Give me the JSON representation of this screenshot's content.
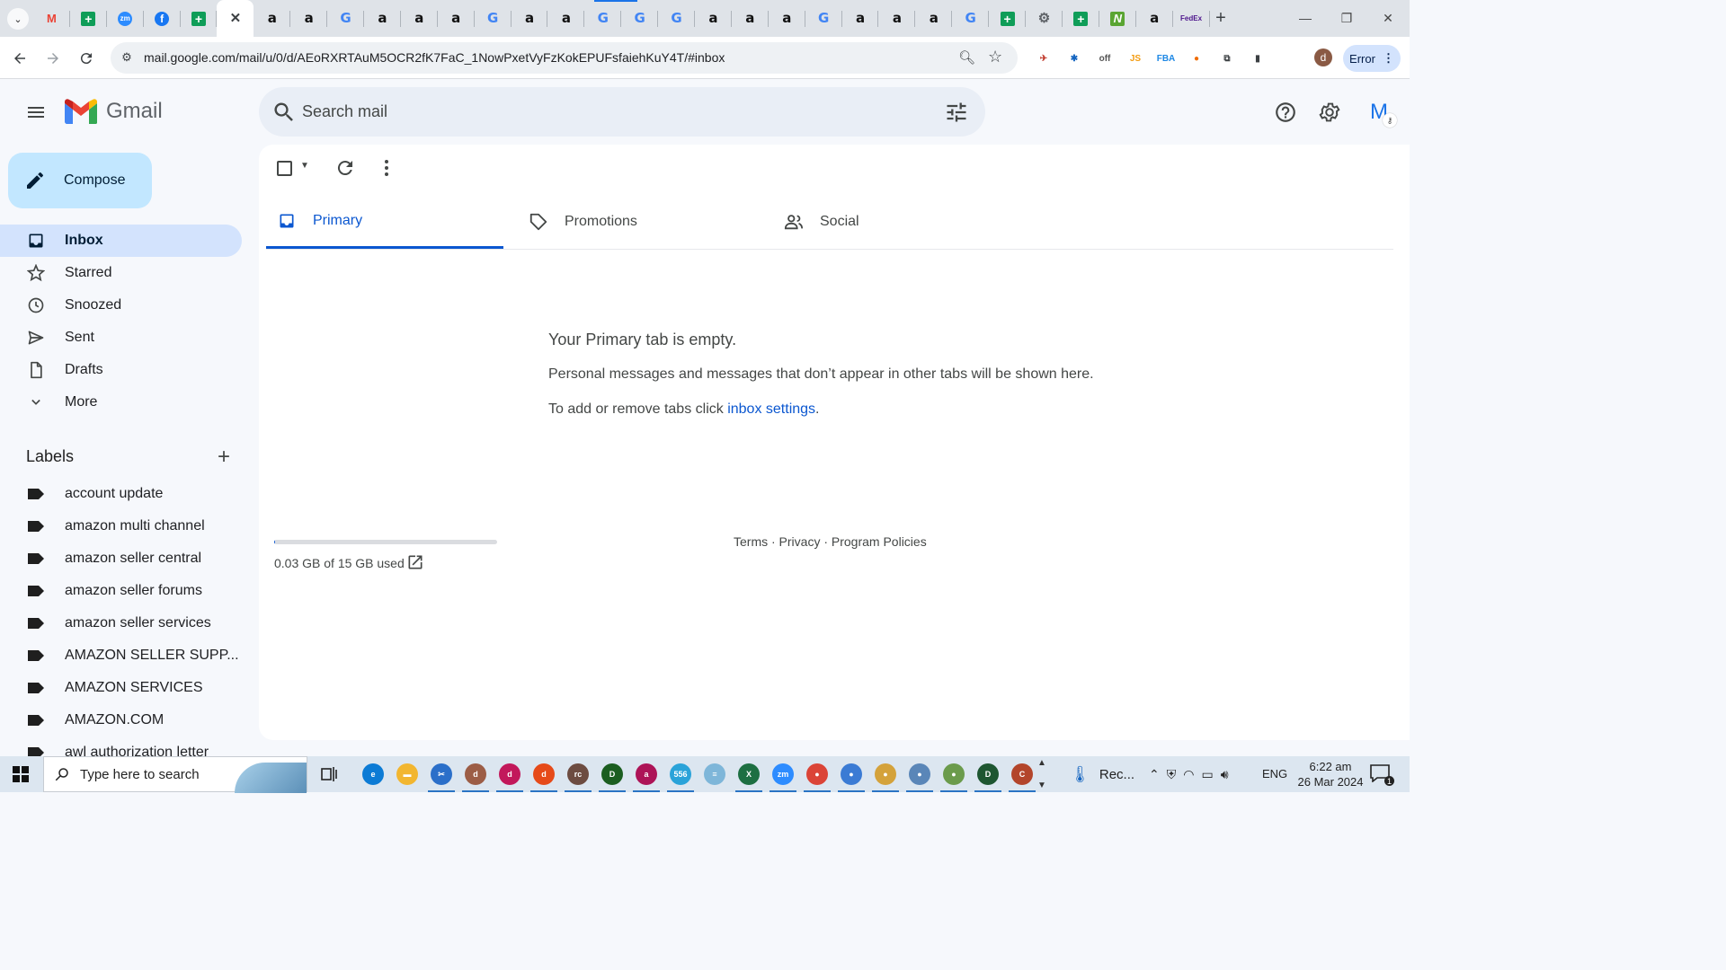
{
  "browser": {
    "tabs": [
      {
        "icon": "gmail-icon",
        "glyph": "M"
      },
      {
        "icon": "sheets-icon",
        "glyph": "+"
      },
      {
        "icon": "zoom-icon",
        "glyph": "zm"
      },
      {
        "icon": "facebook-icon",
        "glyph": "f"
      },
      {
        "icon": "sheets-icon",
        "glyph": "+"
      },
      {
        "icon": "close-icon",
        "glyph": "✕",
        "active": true
      },
      {
        "icon": "amazon-icon",
        "glyph": "a"
      },
      {
        "icon": "amazon-icon",
        "glyph": "a"
      },
      {
        "icon": "google-icon",
        "glyph": "G"
      },
      {
        "icon": "amazon-icon",
        "glyph": "a"
      },
      {
        "icon": "amazon-icon",
        "glyph": "a"
      },
      {
        "icon": "amazon-icon",
        "glyph": "a"
      },
      {
        "icon": "google-icon",
        "glyph": "G"
      },
      {
        "icon": "amazon-icon",
        "glyph": "a"
      },
      {
        "icon": "amazon-icon",
        "glyph": "a"
      },
      {
        "icon": "google-icon",
        "glyph": "G"
      },
      {
        "icon": "google-icon",
        "glyph": "G"
      },
      {
        "icon": "google-icon",
        "glyph": "G"
      },
      {
        "icon": "amazon-icon",
        "glyph": "a"
      },
      {
        "icon": "amazon-icon",
        "glyph": "a"
      },
      {
        "icon": "amazon-icon",
        "glyph": "a"
      },
      {
        "icon": "google-icon",
        "glyph": "G"
      },
      {
        "icon": "amazon-icon",
        "glyph": "a"
      },
      {
        "icon": "amazon-icon",
        "glyph": "a"
      },
      {
        "icon": "amazon-icon",
        "glyph": "a"
      },
      {
        "icon": "google-icon",
        "glyph": "G"
      },
      {
        "icon": "sheets-icon",
        "glyph": "+"
      },
      {
        "icon": "gear-icon",
        "glyph": "⚙"
      },
      {
        "icon": "sheets-icon",
        "glyph": "+"
      },
      {
        "icon": "n-app-icon",
        "glyph": "N"
      },
      {
        "icon": "amazon-icon",
        "glyph": "a"
      },
      {
        "icon": "fedex-icon",
        "glyph": "FedEx"
      }
    ],
    "url": "mail.google.com/mail/u/0/d/AEoRXRTAuM5OCR2fK7FaC_1NowPxetVyFzKokEPUFsfaiehKuY4T/#inbox",
    "profile_initial": "d",
    "error_label": "Error",
    "extensions": [
      {
        "icon": "extension-1-icon",
        "glyph": "✈",
        "color": "#c0392b"
      },
      {
        "icon": "extension-2-icon",
        "glyph": "✱",
        "color": "#1565c0"
      },
      {
        "icon": "extension-off-icon",
        "glyph": "off",
        "color": "#555555"
      },
      {
        "icon": "extension-js-icon",
        "glyph": "JS",
        "color": "#f39c12"
      },
      {
        "icon": "extension-fba-icon",
        "glyph": "FBA",
        "color": "#1e88e5"
      },
      {
        "icon": "extension-circle-icon",
        "glyph": "●",
        "color": "#ef6c00"
      },
      {
        "icon": "puzzle-icon",
        "glyph": "⧉",
        "color": "#3c4043"
      },
      {
        "icon": "side-panel-icon",
        "glyph": "▮",
        "color": "#3c4043"
      }
    ]
  },
  "gmail": {
    "wordmark": "Gmail",
    "search_placeholder": "Search mail",
    "account_initial": "M",
    "compose_label": "Compose",
    "nav": [
      {
        "name": "inbox",
        "label": "Inbox",
        "active": true
      },
      {
        "name": "starred",
        "label": "Starred"
      },
      {
        "name": "snoozed",
        "label": "Snoozed"
      },
      {
        "name": "sent",
        "label": "Sent"
      },
      {
        "name": "drafts",
        "label": "Drafts"
      },
      {
        "name": "more",
        "label": "More"
      }
    ],
    "labels_heading": "Labels",
    "labels": [
      "account update",
      "amazon multi channel",
      "amazon seller central",
      "amazon seller forums",
      "amazon seller services",
      "AMAZON SELLER SUPP...",
      "AMAZON SERVICES",
      "AMAZON.COM",
      "awl authorization letter"
    ],
    "category_tabs": {
      "primary": "Primary",
      "promotions": "Promotions",
      "social": "Social"
    },
    "empty_state": {
      "title": "Your Primary tab is empty.",
      "description": "Personal messages and messages that don’t appear in other tabs will be shown here.",
      "hint_prefix": "To add or remove tabs click ",
      "hint_link": "inbox settings",
      "hint_suffix": "."
    },
    "storage": {
      "text": "0.03 GB of 15 GB used",
      "used_fraction": 0.002
    },
    "footer": "Terms · Privacy · Program Policies"
  },
  "taskbar": {
    "search_placeholder": "Type here to search",
    "apps": [
      {
        "icon": "edge-icon",
        "glyph": "e",
        "color": "#0c7bd5",
        "running": false
      },
      {
        "icon": "file-explorer-icon",
        "glyph": "▬",
        "color": "#f2b630",
        "running": false
      },
      {
        "icon": "snipping-tool-icon",
        "glyph": "✂",
        "color": "#2b6fc9",
        "running": true
      },
      {
        "icon": "chrome-profile-d-icon",
        "glyph": "d",
        "color": "#9c5d46",
        "running": true
      },
      {
        "icon": "chrome-profile-d2-icon",
        "glyph": "d",
        "color": "#c2185b",
        "running": true
      },
      {
        "icon": "chrome-profile-d3-icon",
        "glyph": "d",
        "color": "#e64a19",
        "running": true
      },
      {
        "icon": "chrome-profile-rc-icon",
        "glyph": "rc",
        "color": "#6d4c41",
        "running": true
      },
      {
        "icon": "chrome-profile-d4-icon",
        "glyph": "D",
        "color": "#1b5e20",
        "running": true
      },
      {
        "icon": "chrome-profile-a-icon",
        "glyph": "a",
        "color": "#ad1457",
        "running": true
      },
      {
        "icon": "telegram-icon",
        "glyph": "556",
        "color": "#2aa3d9",
        "running": true
      },
      {
        "icon": "notes-icon",
        "glyph": "≡",
        "color": "#7eb6d9",
        "running": false
      },
      {
        "icon": "excel-icon",
        "glyph": "X",
        "color": "#1d6f42",
        "running": true
      },
      {
        "icon": "zoom-app-icon",
        "glyph": "zm",
        "color": "#2d8cff",
        "running": true
      },
      {
        "icon": "chrome-icon",
        "glyph": "●",
        "color": "#db4437",
        "running": true
      },
      {
        "icon": "chrome-profile-1-icon",
        "glyph": "●",
        "color": "#3b7bd4",
        "running": true
      },
      {
        "icon": "chrome-profile-2-icon",
        "glyph": "●",
        "color": "#d4a23b",
        "running": true
      },
      {
        "icon": "chrome-profile-3-icon",
        "glyph": "●",
        "color": "#5a86b8",
        "running": true
      },
      {
        "icon": "chrome-profile-4-icon",
        "glyph": "●",
        "color": "#6b9b4c",
        "running": true
      },
      {
        "icon": "chrome-profile-5-icon",
        "glyph": "D",
        "color": "#1e5631",
        "running": true
      },
      {
        "icon": "chrome-profile-6-icon",
        "glyph": "C",
        "color": "#b3452b",
        "running": true
      }
    ],
    "rec_label": "Rec...",
    "language": "ENG",
    "time": "6:22 am",
    "date": "26 Mar 2024",
    "notification_count": "1"
  }
}
